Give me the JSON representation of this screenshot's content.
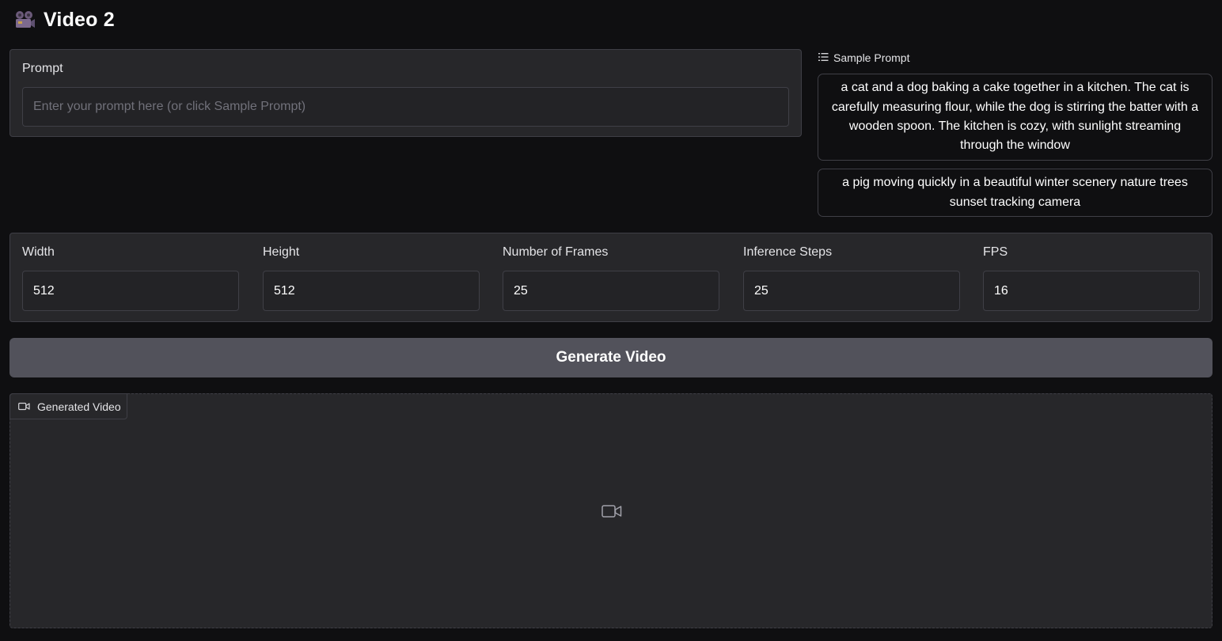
{
  "header": {
    "title": "Video 2",
    "emoji_icon": "movie-camera-icon"
  },
  "prompt": {
    "label": "Prompt",
    "value": "",
    "placeholder": "Enter your prompt here (or click Sample Prompt)"
  },
  "samples": {
    "label": "Sample Prompt",
    "items": [
      "a cat and a dog baking a cake together in a kitchen. The cat is carefully measuring flour, while the dog is stirring the batter with a wooden spoon. The kitchen is cozy, with sunlight streaming through the window",
      "a pig moving quickly in a beautiful winter scenery nature trees sunset tracking camera"
    ]
  },
  "params": {
    "width": {
      "label": "Width",
      "value": "512"
    },
    "height": {
      "label": "Height",
      "value": "512"
    },
    "frames": {
      "label": "Number of Frames",
      "value": "25"
    },
    "steps": {
      "label": "Inference Steps",
      "value": "25"
    },
    "fps": {
      "label": "FPS",
      "value": "16"
    }
  },
  "generate_button": {
    "label": "Generate Video"
  },
  "output": {
    "label": "Generated Video"
  },
  "colors": {
    "background": "#0f0f11",
    "panel": "#27272a",
    "border": "#3f3f46",
    "button": "#52525b",
    "text": "#f4f4f5",
    "muted": "#71717a"
  }
}
